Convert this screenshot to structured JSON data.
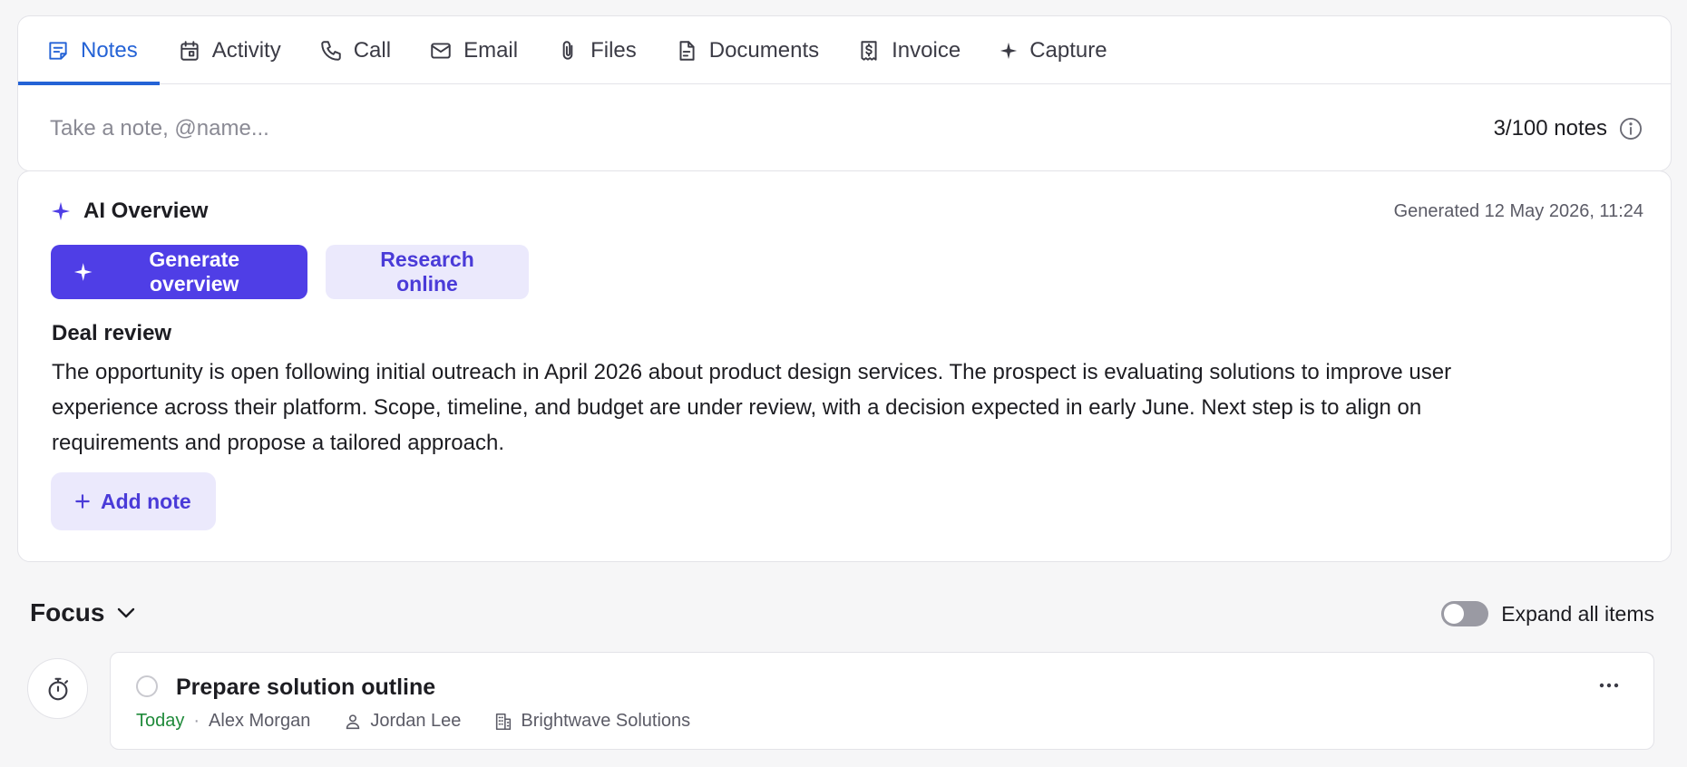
{
  "tabs": [
    {
      "label": "Notes",
      "icon": "notes-icon",
      "active": true
    },
    {
      "label": "Activity",
      "icon": "calendar-icon",
      "active": false
    },
    {
      "label": "Call",
      "icon": "phone-icon",
      "active": false
    },
    {
      "label": "Email",
      "icon": "mail-icon",
      "active": false
    },
    {
      "label": "Files",
      "icon": "paperclip-icon",
      "active": false
    },
    {
      "label": "Documents",
      "icon": "document-icon",
      "active": false
    },
    {
      "label": "Invoice",
      "icon": "receipt-icon",
      "active": false
    },
    {
      "label": "Capture",
      "icon": "sparkle-icon",
      "active": false
    }
  ],
  "note_input": {
    "placeholder": "Take a note, @name...",
    "value": ""
  },
  "note_count": "3/100 notes",
  "ai_overview": {
    "title": "AI Overview",
    "generated": "Generated 12 May 2026, 11:24",
    "generate_label": "Generate overview",
    "research_label": "Research online",
    "section_title": "Deal review",
    "body": "The opportunity is open following initial outreach in April 2026 about product design services. The prospect is evaluating solutions to improve user experience across their platform. Scope, timeline, and budget are under review, with a decision expected in early June. Next step is to align on requirements and propose a tailored approach.",
    "add_note_label": "Add note"
  },
  "focus": {
    "title": "Focus",
    "expand_label": "Expand all items",
    "expand_on": false,
    "task": {
      "title": "Prepare solution outline",
      "due": "Today",
      "owner": "Alex Morgan",
      "assignee": "Jordan Lee",
      "company": "Brightwave Solutions"
    }
  },
  "colors": {
    "accent_blue": "#2563d6",
    "primary_purple": "#4f3ee6",
    "soft_purple": "#ebe9fc",
    "due_green": "#1f8a3a"
  }
}
